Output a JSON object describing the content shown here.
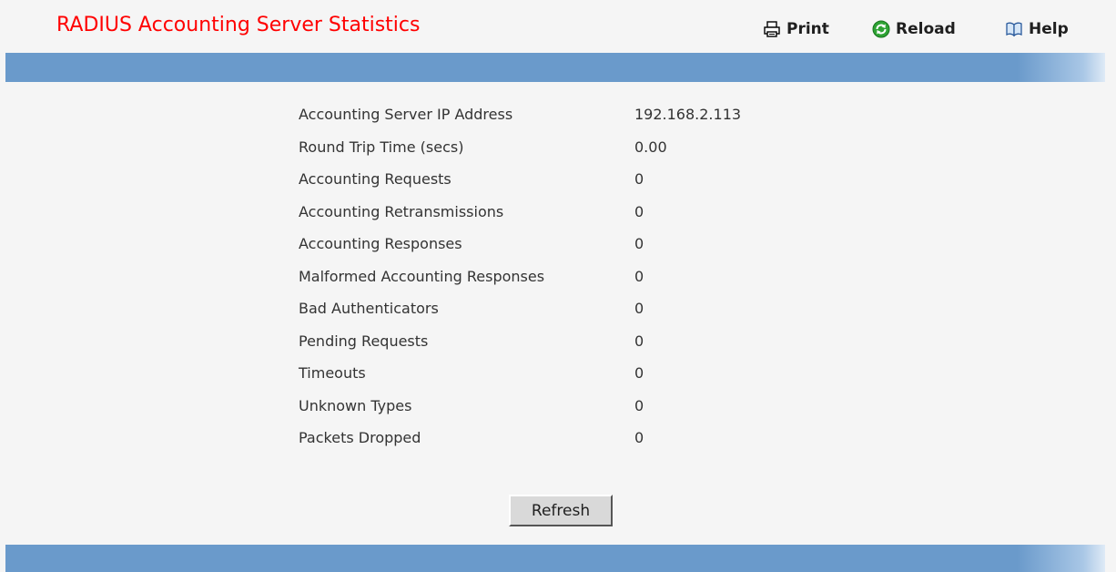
{
  "header": {
    "title": "RADIUS Accounting Server Statistics",
    "title_color": "#ff0000",
    "toolbar": [
      {
        "label": "Print",
        "icon": "printer-icon"
      },
      {
        "label": "Reload",
        "icon": "reload-icon"
      },
      {
        "label": "Help",
        "icon": "book-icon"
      }
    ]
  },
  "band_color": "#6a9acb",
  "stats": [
    {
      "label": "Accounting Server IP Address",
      "value": "192.168.2.113"
    },
    {
      "label": "Round Trip Time (secs)",
      "value": "0.00"
    },
    {
      "label": "Accounting Requests",
      "value": "0"
    },
    {
      "label": "Accounting Retransmissions",
      "value": "0"
    },
    {
      "label": "Accounting Responses",
      "value": "0"
    },
    {
      "label": "Malformed Accounting Responses",
      "value": "0"
    },
    {
      "label": "Bad Authenticators",
      "value": "0"
    },
    {
      "label": "Pending Requests",
      "value": "0"
    },
    {
      "label": "Timeouts",
      "value": "0"
    },
    {
      "label": "Unknown Types",
      "value": "0"
    },
    {
      "label": "Packets Dropped",
      "value": "0"
    }
  ],
  "actions": {
    "refresh_label": "Refresh"
  }
}
